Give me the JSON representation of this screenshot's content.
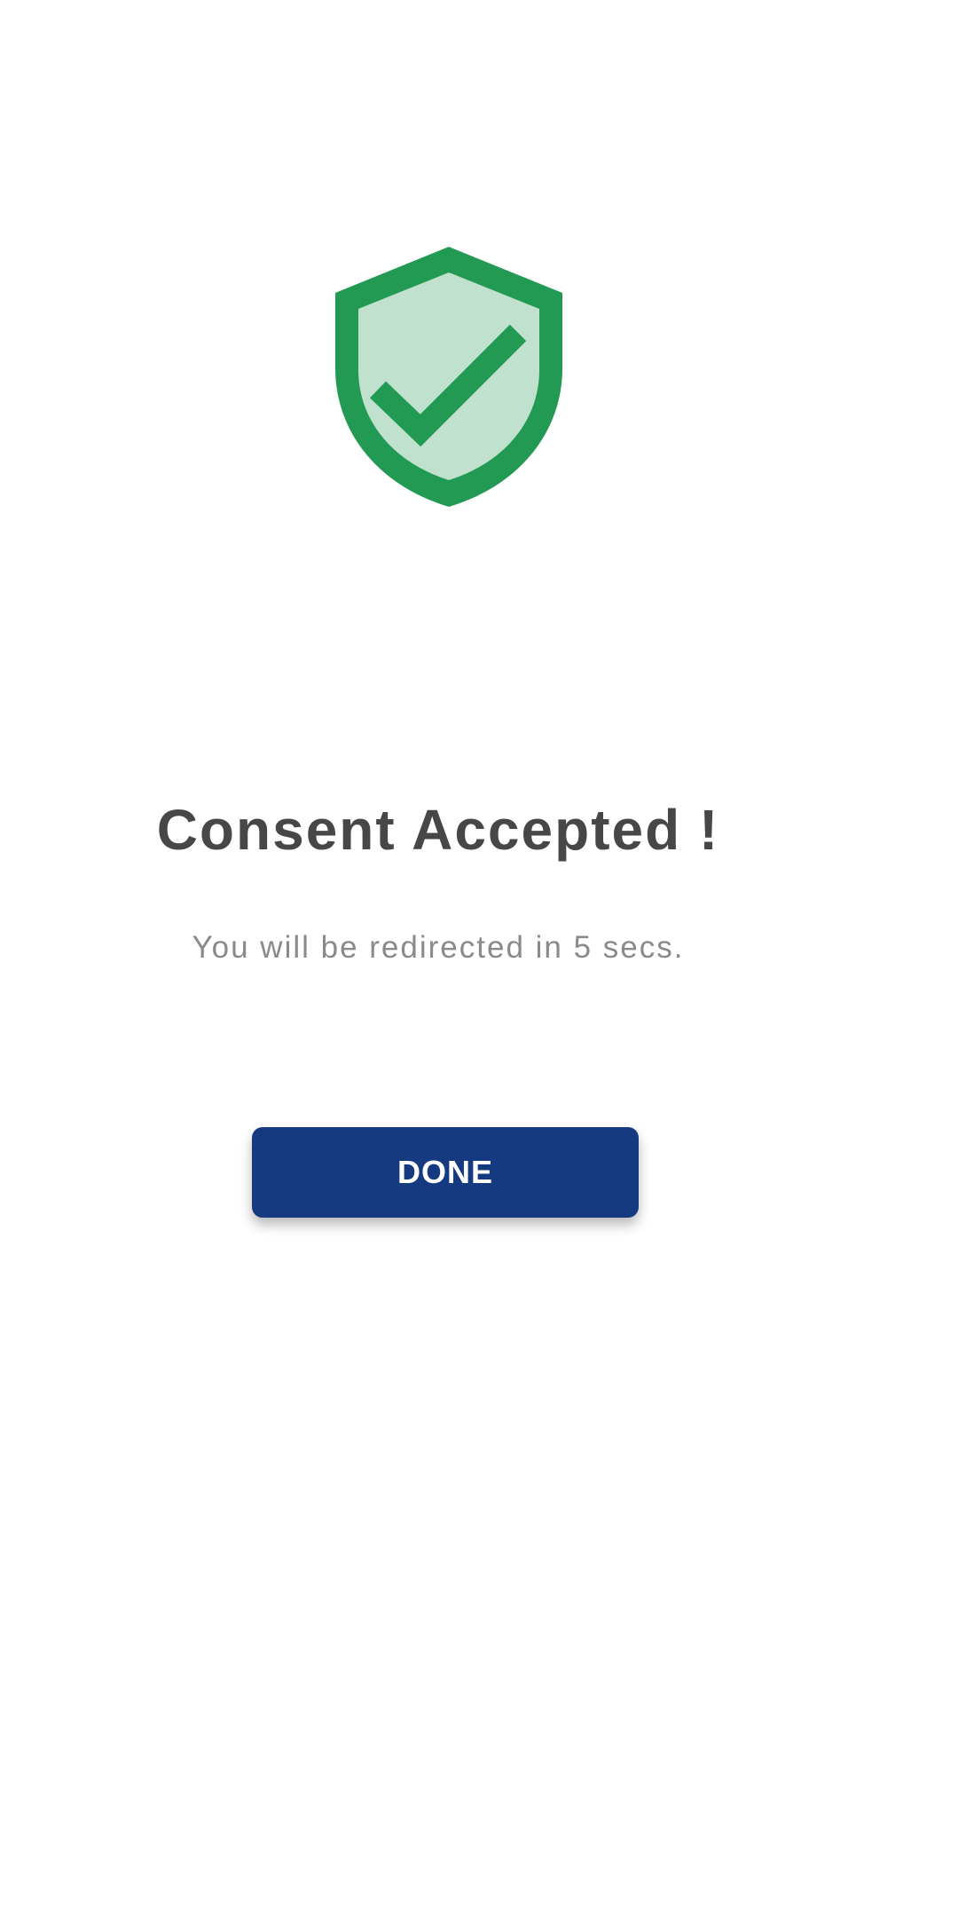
{
  "screen": {
    "icon": "shield-check-icon",
    "title": "Consent Accepted !",
    "subtitle": "You will be redirected in 5 secs.",
    "done_label": "DONE"
  },
  "colors": {
    "shield_outline": "#239A53",
    "shield_fill": "#BFE1CD",
    "button_bg": "#153A80",
    "title_text": "#474747",
    "subtitle_text": "#8A8A8A"
  }
}
